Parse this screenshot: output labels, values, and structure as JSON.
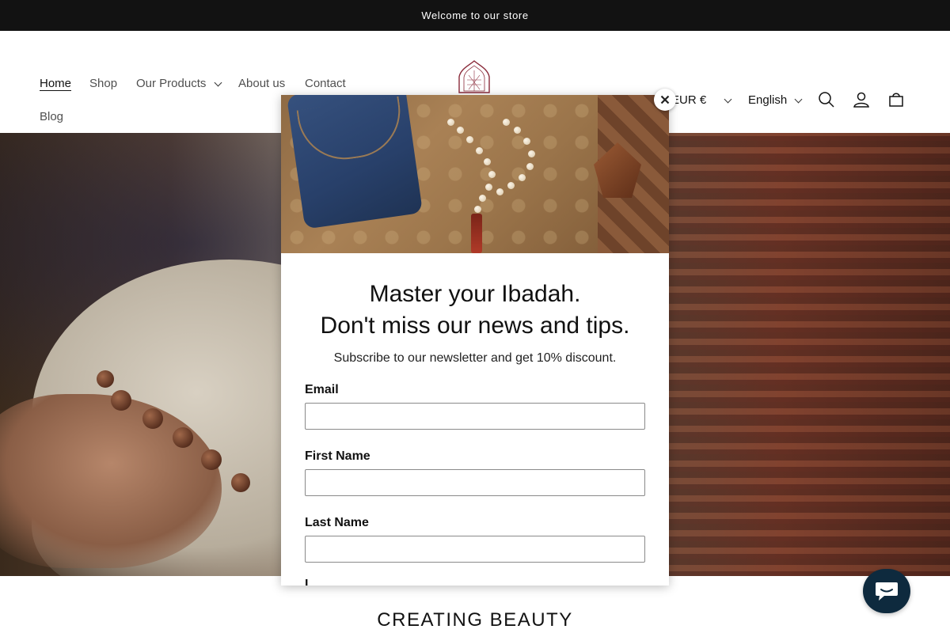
{
  "announcement": "Welcome to our store",
  "nav": {
    "home": "Home",
    "shop": "Shop",
    "our_products": "Our Products",
    "about": "About us",
    "contact": "Contact",
    "blog": "Blog"
  },
  "header": {
    "currency": "EUR €",
    "language": "English",
    "icons": [
      "search-icon",
      "account-icon",
      "cart-icon"
    ]
  },
  "below_hero": {
    "title": "CREATING BEAUTY"
  },
  "popup": {
    "headline_line1": "Master your Ibadah.",
    "headline_line2": "Don't miss our news and tips.",
    "subtext": "Subscribe to our newsletter and get 10% discount.",
    "fields": [
      {
        "label": "Email",
        "value": ""
      },
      {
        "label": "First Name",
        "value": ""
      },
      {
        "label": "Last Name",
        "value": ""
      }
    ],
    "next_label_partial": "L"
  },
  "colors": {
    "announcement_bg": "#121212",
    "chat_bg": "#0e2a3e",
    "logo": "#8a2a3a"
  }
}
